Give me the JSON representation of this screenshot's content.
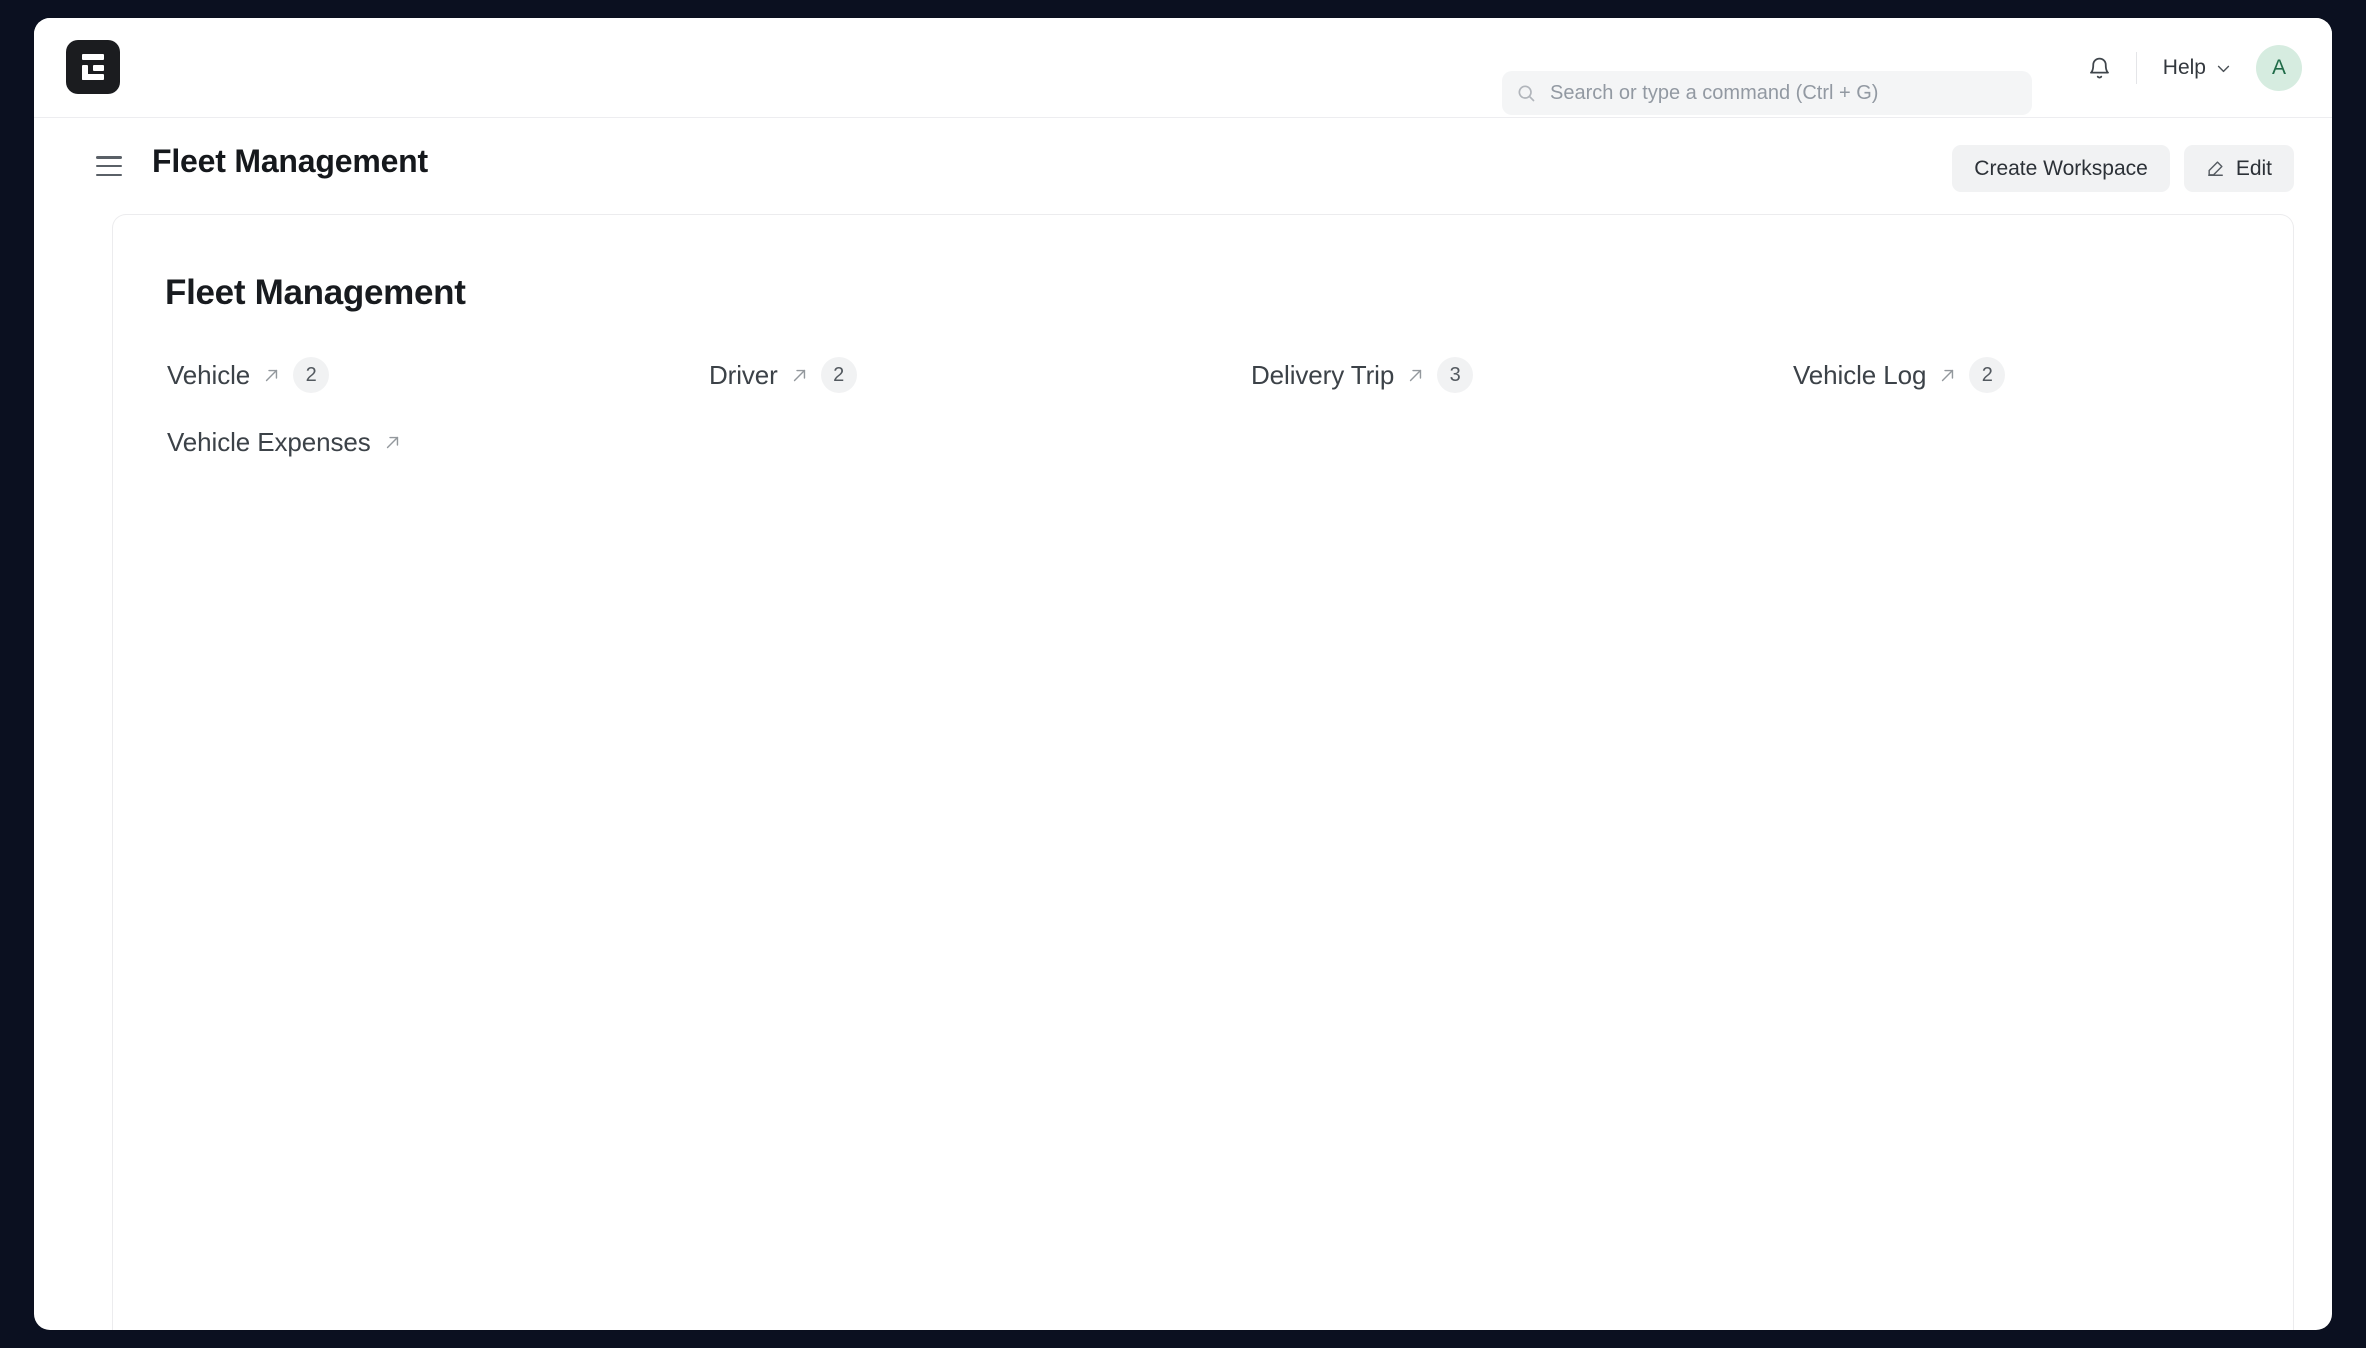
{
  "navbar": {
    "logo_icon": "erpnext-logo-icon",
    "search": {
      "placeholder": "Search or type a command (Ctrl + G)",
      "value": "",
      "icon": "search-icon"
    },
    "notification_icon": "bell-icon",
    "help": {
      "label": "Help",
      "chevron_icon": "chevron-down-icon"
    },
    "avatar": {
      "initial": "A",
      "bg_color": "#d6ece0",
      "text_color": "#1f6b48"
    }
  },
  "page_header": {
    "menu_icon": "hamburger-menu-icon",
    "title": "Fleet Management",
    "actions": {
      "create_workspace_label": "Create Workspace",
      "edit_label": "Edit",
      "edit_icon": "edit-pencil-icon"
    }
  },
  "workspace": {
    "title": "Fleet Management",
    "shortcuts": [
      {
        "label": "Vehicle",
        "count": "2",
        "arrow_icon": "arrow-up-right-icon"
      },
      {
        "label": "Driver",
        "count": "2",
        "arrow_icon": "arrow-up-right-icon"
      },
      {
        "label": "Delivery Trip",
        "count": "3",
        "arrow_icon": "arrow-up-right-icon"
      },
      {
        "label": "Vehicle Log",
        "count": "2",
        "arrow_icon": "arrow-up-right-icon"
      },
      {
        "label": "Vehicle Expenses",
        "count": "",
        "arrow_icon": "arrow-up-right-icon"
      }
    ]
  },
  "theme": {
    "frame_bg": "#0b1020",
    "surface": "#ffffff",
    "muted_bg": "#f1f2f3",
    "border": "#ececee",
    "text_primary": "#15181c",
    "text_secondary": "#3c4248"
  }
}
